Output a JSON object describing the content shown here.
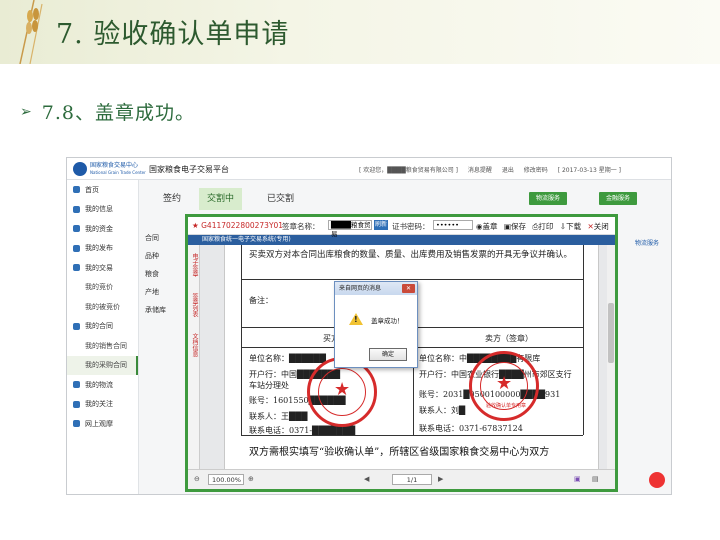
{
  "slide": {
    "title": "7. 验收确认单申请",
    "subtitle": "7.8、盖章成功。"
  },
  "app": {
    "platform_name": "国家粮食电子交易平台",
    "logo_line1": "国家粮食交易中心",
    "logo_line2": "National Grain Trade Center",
    "top_info": {
      "welcome": "[ 欢迎您，",
      "welcome_user": "████粮食贸易有限公司 ]",
      "messages": "消息提醒",
      "logout": "退出",
      "change_password": "修改密码",
      "date": "[ 2017-03-13 星期一 ]"
    },
    "nav": [
      {
        "label": "首页",
        "sub": false
      },
      {
        "label": "我的信息",
        "sub": false
      },
      {
        "label": "我的资金",
        "sub": false
      },
      {
        "label": "我的发布",
        "sub": false
      },
      {
        "label": "我的交易",
        "sub": false
      },
      {
        "label": "我的竞价",
        "sub": true
      },
      {
        "label": "我的被竞价",
        "sub": true
      },
      {
        "label": "我的合同",
        "sub": false
      },
      {
        "label": "我的销售合同",
        "sub": true
      },
      {
        "label": "我的采购合同",
        "sub": true,
        "active": true
      },
      {
        "label": "我的物流",
        "sub": false
      },
      {
        "label": "我的关注",
        "sub": false
      },
      {
        "label": "网上观摩",
        "sub": false
      }
    ],
    "tabs": {
      "sign": "签约",
      "in_progress": "交割中",
      "done": "已交割"
    },
    "buttons": {
      "logistics": "物流服务",
      "bank": "金融服务"
    },
    "bg_rows": [
      "合同",
      "品种",
      "粮食",
      "产地",
      "承储库"
    ],
    "bg_right": "物流服务"
  },
  "modal": {
    "contract_id": "G4117022800273Y01",
    "sign_name_label": "签章名称：",
    "sign_name_value": "████粮食贸易",
    "blue_btn": "刷新",
    "cert_password_label": "证书密码：",
    "cert_password_value": "••••••",
    "tools": {
      "stamp": "盖章",
      "save": "保存",
      "print": "打印",
      "download": "下载",
      "close": "关闭"
    },
    "doc_bar": "国家粮食统一电子交易系统(专用)",
    "side_tabs": [
      "电子签章",
      "签章列表",
      "文档信息"
    ],
    "doc": {
      "para": "买卖双方对本合同出库粮食的数量、质量、出库费用及销售发票的开具无争议并确认。",
      "remarks": "备注：",
      "buyer_header": "买方（签章）",
      "seller_header": "卖方（签章）",
      "buyer_unit": "单位名称：██████",
      "buyer_bank": "开户行：中国███████",
      "buyer_branch": "车站分理处",
      "buyer_account": "账号：1601550██████",
      "buyer_contact": "联系人：王███",
      "buyer_phone": "联系电话：0371-███████",
      "seller_unit": "单位名称：中████████有限库",
      "seller_bank": "开户行：中国农业银行████州市郊区支行",
      "seller_account": "账号：2031█0500100000████931",
      "seller_contact": "联系人：刘█",
      "seller_phone": "联系电话：0371-67837124",
      "seal_text": "验收确认单专用章",
      "footer": "双方需根实填写“验收确认单”，所辖区省级国家粮食交易中心为双方"
    },
    "footer": {
      "zoom": "100.00%",
      "page": "1/1"
    }
  },
  "alert": {
    "title": "来自网页的消息",
    "message": "盖章成功！",
    "ok": "确定"
  },
  "colors": {
    "accent_green": "#3e9a3e",
    "seal_red": "#d62b2b",
    "title_green": "#2d5a2f",
    "link_blue": "#1e5aa8"
  }
}
